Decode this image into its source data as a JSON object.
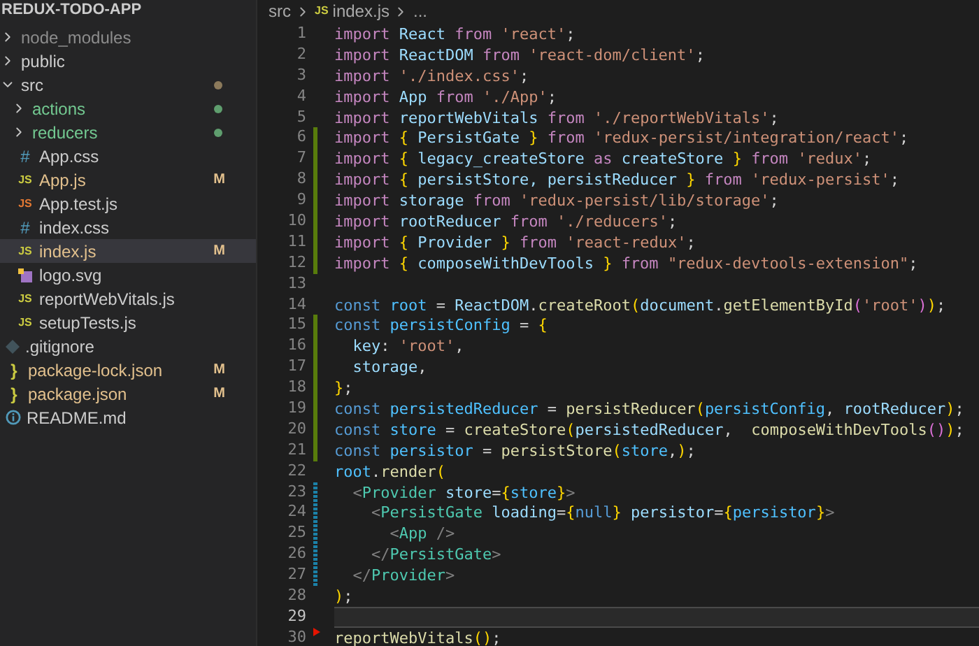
{
  "explorer": {
    "title": "REDUX-TODO-APP",
    "items": [
      {
        "name": "node_modules",
        "kind": "folder",
        "expanded": false,
        "color": "#8c8c8c",
        "selected": false
      },
      {
        "name": "public",
        "kind": "folder",
        "expanded": false,
        "color": "#cccccc",
        "selected": false
      },
      {
        "name": "src",
        "kind": "folder",
        "expanded": true,
        "color": "#cccccc",
        "selected": false,
        "dot": {
          "color": "#8c7a5b"
        },
        "children": [
          {
            "name": "actions",
            "kind": "folder",
            "expanded": false,
            "color": "#73c991",
            "selected": false,
            "dot": {
              "color": "#5f9e6e"
            }
          },
          {
            "name": "reducers",
            "kind": "folder",
            "expanded": false,
            "color": "#73c991",
            "selected": false,
            "dot": {
              "color": "#5f9e6e"
            }
          },
          {
            "name": "App.css",
            "kind": "css",
            "icon": "#",
            "color": "#cccccc",
            "selected": false
          },
          {
            "name": "App.js",
            "kind": "js",
            "icon": "JS",
            "color": "#e2c08d",
            "badge": "M",
            "selected": false
          },
          {
            "name": "App.test.js",
            "kind": "test",
            "icon": "JS",
            "color": "#cccccc",
            "selected": false
          },
          {
            "name": "index.css",
            "kind": "css",
            "icon": "#",
            "color": "#cccccc",
            "selected": false
          },
          {
            "name": "index.js",
            "kind": "js",
            "icon": "JS",
            "color": "#e2c08d",
            "badge": "M",
            "selected": true
          },
          {
            "name": "logo.svg",
            "kind": "image",
            "color": "#cccccc",
            "selected": false
          },
          {
            "name": "reportWebVitals.js",
            "kind": "js",
            "icon": "JS",
            "color": "#cccccc",
            "selected": false
          },
          {
            "name": "setupTests.js",
            "kind": "js",
            "icon": "JS",
            "color": "#cccccc",
            "selected": false
          }
        ]
      },
      {
        "name": ".gitignore",
        "kind": "git",
        "color": "#cccccc",
        "selected": false
      },
      {
        "name": "package-lock.json",
        "kind": "json",
        "icon": "}",
        "color": "#e2c08d",
        "badge": "M",
        "selected": false
      },
      {
        "name": "package.json",
        "kind": "json",
        "icon": "}",
        "color": "#e2c08d",
        "badge": "M",
        "selected": false
      },
      {
        "name": "README.md",
        "kind": "md",
        "color": "#cccccc",
        "selected": false
      }
    ]
  },
  "breadcrumb": {
    "folder": "src",
    "file_icon": "JS",
    "file": "index.js",
    "more": "..."
  },
  "editor": {
    "lines": [
      {
        "number": "1",
        "kind": "unchanged",
        "current": false,
        "tokens": [
          {
            "text": "import ",
            "kind": "kw"
          },
          {
            "text": "React ",
            "kind": "var"
          },
          {
            "text": "from ",
            "kind": "kw"
          },
          {
            "text": "'react'",
            "kind": "str"
          },
          {
            "text": ";",
            "kind": "plain"
          }
        ]
      },
      {
        "number": "2",
        "kind": "unchanged",
        "current": false,
        "tokens": [
          {
            "text": "import ",
            "kind": "kw"
          },
          {
            "text": "ReactDOM ",
            "kind": "var"
          },
          {
            "text": "from ",
            "kind": "kw"
          },
          {
            "text": "'react-dom/client'",
            "kind": "str"
          },
          {
            "text": ";",
            "kind": "plain"
          }
        ]
      },
      {
        "number": "3",
        "kind": "unchanged",
        "current": false,
        "tokens": [
          {
            "text": "import ",
            "kind": "kw"
          },
          {
            "text": "'./index.css'",
            "kind": "str"
          },
          {
            "text": ";",
            "kind": "plain"
          }
        ]
      },
      {
        "number": "4",
        "kind": "unchanged",
        "current": false,
        "tokens": [
          {
            "text": "import ",
            "kind": "kw"
          },
          {
            "text": "App ",
            "kind": "var"
          },
          {
            "text": "from ",
            "kind": "kw"
          },
          {
            "text": "'./App'",
            "kind": "str"
          },
          {
            "text": ";",
            "kind": "plain"
          }
        ]
      },
      {
        "number": "5",
        "kind": "unchanged",
        "current": false,
        "tokens": [
          {
            "text": "import ",
            "kind": "kw"
          },
          {
            "text": "reportWebVitals ",
            "kind": "var"
          },
          {
            "text": "from ",
            "kind": "kw"
          },
          {
            "text": "'./reportWebVitals'",
            "kind": "str"
          },
          {
            "text": ";",
            "kind": "plain"
          }
        ]
      },
      {
        "number": "6",
        "kind": "added",
        "current": false,
        "tokens": [
          {
            "text": "import ",
            "kind": "kw"
          },
          {
            "text": "{ ",
            "kind": "brace"
          },
          {
            "text": "PersistGate ",
            "kind": "var"
          },
          {
            "text": "} ",
            "kind": "brace"
          },
          {
            "text": "from ",
            "kind": "kw"
          },
          {
            "text": "'redux-persist/integration/react'",
            "kind": "str"
          },
          {
            "text": ";",
            "kind": "plain"
          }
        ]
      },
      {
        "number": "7",
        "kind": "added",
        "current": false,
        "tokens": [
          {
            "text": "import ",
            "kind": "kw"
          },
          {
            "text": "{ ",
            "kind": "brace"
          },
          {
            "text": "legacy_createStore ",
            "kind": "var"
          },
          {
            "text": "as ",
            "kind": "kw"
          },
          {
            "text": "createStore ",
            "kind": "var"
          },
          {
            "text": "} ",
            "kind": "brace"
          },
          {
            "text": "from ",
            "kind": "kw"
          },
          {
            "text": "'redux'",
            "kind": "str"
          },
          {
            "text": ";",
            "kind": "plain"
          }
        ]
      },
      {
        "number": "8",
        "kind": "added",
        "current": false,
        "tokens": [
          {
            "text": "import ",
            "kind": "kw"
          },
          {
            "text": "{ ",
            "kind": "brace"
          },
          {
            "text": "persistStore, persistReducer ",
            "kind": "var"
          },
          {
            "text": "} ",
            "kind": "brace"
          },
          {
            "text": "from ",
            "kind": "kw"
          },
          {
            "text": "'redux-persist'",
            "kind": "str"
          },
          {
            "text": ";",
            "kind": "plain"
          }
        ]
      },
      {
        "number": "9",
        "kind": "added",
        "current": false,
        "tokens": [
          {
            "text": "import ",
            "kind": "kw"
          },
          {
            "text": "storage ",
            "kind": "var"
          },
          {
            "text": "from ",
            "kind": "kw"
          },
          {
            "text": "'redux-persist/lib/storage'",
            "kind": "str"
          },
          {
            "text": ";",
            "kind": "plain"
          }
        ]
      },
      {
        "number": "10",
        "kind": "added",
        "current": false,
        "tokens": [
          {
            "text": "import ",
            "kind": "kw"
          },
          {
            "text": "rootReducer ",
            "kind": "var"
          },
          {
            "text": "from ",
            "kind": "kw"
          },
          {
            "text": "'./reducers'",
            "kind": "str"
          },
          {
            "text": ";",
            "kind": "plain"
          }
        ]
      },
      {
        "number": "11",
        "kind": "added",
        "current": false,
        "tokens": [
          {
            "text": "import ",
            "kind": "kw"
          },
          {
            "text": "{ ",
            "kind": "brace"
          },
          {
            "text": "Provider ",
            "kind": "var"
          },
          {
            "text": "} ",
            "kind": "brace"
          },
          {
            "text": "from ",
            "kind": "kw"
          },
          {
            "text": "'react-redux'",
            "kind": "str"
          },
          {
            "text": ";",
            "kind": "plain"
          }
        ]
      },
      {
        "number": "12",
        "kind": "added",
        "current": false,
        "tokens": [
          {
            "text": "import ",
            "kind": "kw"
          },
          {
            "text": "{ ",
            "kind": "brace"
          },
          {
            "text": "composeWithDevTools ",
            "kind": "var"
          },
          {
            "text": "} ",
            "kind": "brace"
          },
          {
            "text": "from ",
            "kind": "kw"
          },
          {
            "text": "\"redux-devtools-extension\"",
            "kind": "str"
          },
          {
            "text": ";",
            "kind": "plain"
          }
        ]
      },
      {
        "number": "13",
        "kind": "unchanged",
        "current": false
      },
      {
        "number": "14",
        "kind": "unchanged",
        "current": false,
        "tokens": [
          {
            "text": "const ",
            "kind": "const"
          },
          {
            "text": "root ",
            "kind": "cvar"
          },
          {
            "text": "= ",
            "kind": "plain"
          },
          {
            "text": "ReactDOM",
            "kind": "var"
          },
          {
            "text": ".",
            "kind": "plain"
          },
          {
            "text": "createRoot",
            "kind": "fn"
          },
          {
            "text": "(",
            "kind": "brace"
          },
          {
            "text": "document",
            "kind": "var"
          },
          {
            "text": ".",
            "kind": "plain"
          },
          {
            "text": "getElementById",
            "kind": "fn"
          },
          {
            "text": "(",
            "kind": "paren"
          },
          {
            "text": "'root'",
            "kind": "str"
          },
          {
            "text": ")",
            "kind": "paren"
          },
          {
            "text": ")",
            "kind": "brace"
          },
          {
            "text": ";",
            "kind": "plain"
          }
        ]
      },
      {
        "number": "15",
        "kind": "added",
        "current": false,
        "tokens": [
          {
            "text": "const ",
            "kind": "const"
          },
          {
            "text": "persistConfig ",
            "kind": "cvar"
          },
          {
            "text": "= ",
            "kind": "plain"
          },
          {
            "text": "{",
            "kind": "brace"
          }
        ]
      },
      {
        "number": "16",
        "kind": "added",
        "current": false,
        "tokens": [
          {
            "text": "  key",
            "kind": "var"
          },
          {
            "text": ": ",
            "kind": "plain"
          },
          {
            "text": "'root'",
            "kind": "str"
          },
          {
            "text": ",",
            "kind": "plain"
          }
        ]
      },
      {
        "number": "17",
        "kind": "added",
        "current": false,
        "tokens": [
          {
            "text": "  storage",
            "kind": "var"
          },
          {
            "text": ",",
            "kind": "plain"
          }
        ]
      },
      {
        "number": "18",
        "kind": "added",
        "current": false,
        "tokens": [
          {
            "text": "}",
            "kind": "brace"
          },
          {
            "text": ";",
            "kind": "plain"
          }
        ]
      },
      {
        "number": "19",
        "kind": "added",
        "current": false,
        "tokens": [
          {
            "text": "const ",
            "kind": "const"
          },
          {
            "text": "persistedReducer ",
            "kind": "cvar"
          },
          {
            "text": "= ",
            "kind": "plain"
          },
          {
            "text": "persistReducer",
            "kind": "fn"
          },
          {
            "text": "(",
            "kind": "brace"
          },
          {
            "text": "persistConfig",
            "kind": "cvar"
          },
          {
            "text": ", ",
            "kind": "plain"
          },
          {
            "text": "rootReducer",
            "kind": "var"
          },
          {
            "text": ")",
            "kind": "brace"
          },
          {
            "text": ";",
            "kind": "plain"
          }
        ]
      },
      {
        "number": "20",
        "kind": "added",
        "current": false,
        "tokens": [
          {
            "text": "const ",
            "kind": "const"
          },
          {
            "text": "store ",
            "kind": "cvar"
          },
          {
            "text": "= ",
            "kind": "plain"
          },
          {
            "text": "createStore",
            "kind": "fn"
          },
          {
            "text": "(",
            "kind": "brace"
          },
          {
            "text": "persistedReducer",
            "kind": "var"
          },
          {
            "text": ",  ",
            "kind": "plain"
          },
          {
            "text": "composeWithDevTools",
            "kind": "fn"
          },
          {
            "text": "()",
            "kind": "paren"
          },
          {
            "text": ")",
            "kind": "brace"
          },
          {
            "text": ";",
            "kind": "plain"
          }
        ]
      },
      {
        "number": "21",
        "kind": "added",
        "current": false,
        "tokens": [
          {
            "text": "const ",
            "kind": "const"
          },
          {
            "text": "persistor ",
            "kind": "cvar"
          },
          {
            "text": "= ",
            "kind": "plain"
          },
          {
            "text": "persistStore",
            "kind": "fn"
          },
          {
            "text": "(",
            "kind": "brace"
          },
          {
            "text": "store",
            "kind": "cvar"
          },
          {
            "text": ",",
            "kind": "plain"
          },
          {
            "text": ")",
            "kind": "brace"
          },
          {
            "text": ";",
            "kind": "plain"
          }
        ]
      },
      {
        "number": "22",
        "kind": "unchanged",
        "current": false,
        "tokens": [
          {
            "text": "root",
            "kind": "cvar"
          },
          {
            "text": ".",
            "kind": "plain"
          },
          {
            "text": "render",
            "kind": "fn"
          },
          {
            "text": "(",
            "kind": "brace"
          }
        ]
      },
      {
        "number": "23",
        "kind": "modified",
        "current": false,
        "tokens": [
          {
            "text": "  <",
            "kind": "punct"
          },
          {
            "text": "Provider ",
            "kind": "tag"
          },
          {
            "text": "store",
            "kind": "var"
          },
          {
            "text": "=",
            "kind": "plain"
          },
          {
            "text": "{",
            "kind": "brace"
          },
          {
            "text": "store",
            "kind": "cvar"
          },
          {
            "text": "}",
            "kind": "brace"
          },
          {
            "text": ">",
            "kind": "punct"
          }
        ]
      },
      {
        "number": "24",
        "kind": "modified",
        "current": false,
        "tokens": [
          {
            "text": "    <",
            "kind": "punct"
          },
          {
            "text": "PersistGate ",
            "kind": "tag"
          },
          {
            "text": "loading",
            "kind": "var"
          },
          {
            "text": "=",
            "kind": "plain"
          },
          {
            "text": "{",
            "kind": "brace"
          },
          {
            "text": "null",
            "kind": "const"
          },
          {
            "text": "}",
            "kind": "brace"
          },
          {
            "text": " persistor",
            "kind": "var"
          },
          {
            "text": "=",
            "kind": "plain"
          },
          {
            "text": "{",
            "kind": "brace"
          },
          {
            "text": "persistor",
            "kind": "cvar"
          },
          {
            "text": "}",
            "kind": "brace"
          },
          {
            "text": ">",
            "kind": "punct"
          }
        ]
      },
      {
        "number": "25",
        "kind": "modified",
        "current": false,
        "tokens": [
          {
            "text": "      <",
            "kind": "punct"
          },
          {
            "text": "App ",
            "kind": "tag"
          },
          {
            "text": "/>",
            "kind": "punct"
          }
        ]
      },
      {
        "number": "26",
        "kind": "modified",
        "current": false,
        "tokens": [
          {
            "text": "    </",
            "kind": "punct"
          },
          {
            "text": "PersistGate",
            "kind": "tag"
          },
          {
            "text": ">",
            "kind": "punct"
          }
        ]
      },
      {
        "number": "27",
        "kind": "modified",
        "current": false,
        "tokens": [
          {
            "text": "  </",
            "kind": "punct"
          },
          {
            "text": "Provider",
            "kind": "tag"
          },
          {
            "text": ">",
            "kind": "punct"
          }
        ]
      },
      {
        "number": "28",
        "kind": "unchanged",
        "current": false,
        "tokens": [
          {
            "text": ")",
            "kind": "brace"
          },
          {
            "text": ";",
            "kind": "plain"
          }
        ]
      },
      {
        "number": "29",
        "kind": "unchanged",
        "current": true
      },
      {
        "number": "30",
        "kind": "deleted",
        "current": false,
        "tokens": [
          {
            "text": "reportWebVitals",
            "kind": "fn"
          },
          {
            "text": "()",
            "kind": "brace"
          },
          {
            "text": ";",
            "kind": "plain"
          }
        ]
      }
    ]
  }
}
